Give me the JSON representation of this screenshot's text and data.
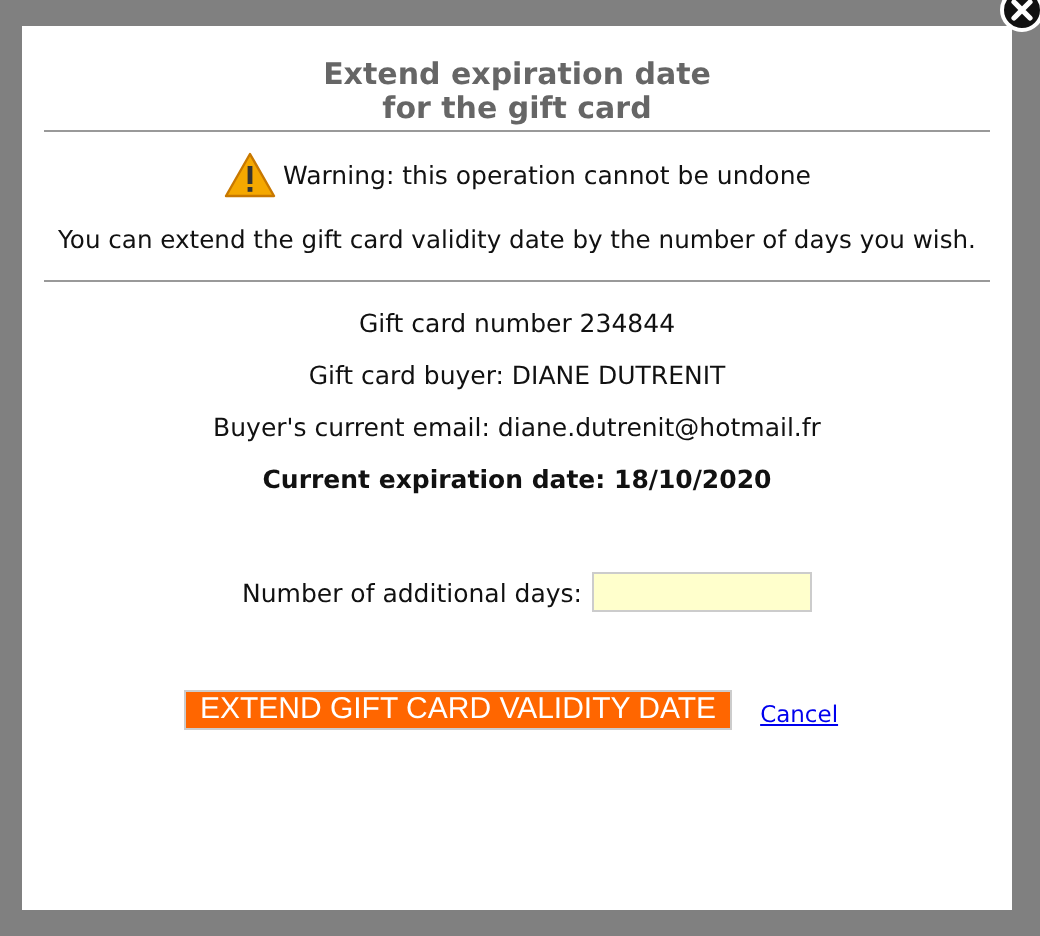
{
  "dialog": {
    "title_lines": [
      "Extend expiration date",
      "for the gift card"
    ],
    "warning": "Warning: this operation cannot be undone",
    "intro": "You can extend the gift card validity date by the number of days you wish.",
    "details": [
      {
        "text": "Gift card number 234844",
        "kind": "plain"
      },
      {
        "text": "Gift card buyer: DIANE DUTRENIT",
        "kind": "plain"
      },
      {
        "text": "Buyer's current email: diane.dutrenit@hotmail.fr",
        "kind": "plain"
      },
      {
        "text": "Current expiration date: 18/10/2020",
        "kind": "bold"
      }
    ],
    "days_field": {
      "label": "Number of additional days:"
    },
    "submit_button": "EXTEND GIFT CARD VALIDITY DATE",
    "cancel_link": "Cancel"
  }
}
